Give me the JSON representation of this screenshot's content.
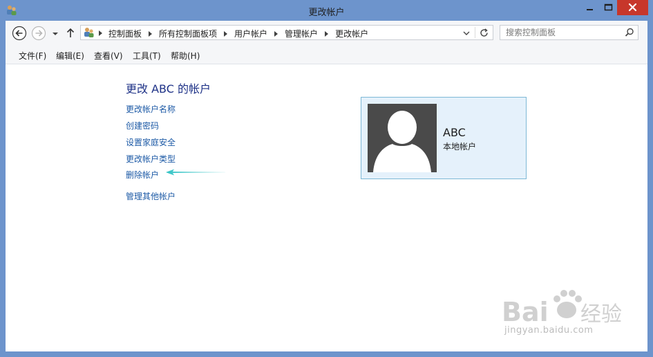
{
  "window": {
    "title": "更改帐户"
  },
  "nav": {
    "breadcrumb": [
      "控制面板",
      "所有控制面板项",
      "用户帐户",
      "管理帐户",
      "更改帐户"
    ],
    "search_placeholder": "搜索控制面板"
  },
  "menu": [
    "文件(F)",
    "编辑(E)",
    "查看(V)",
    "工具(T)",
    "帮助(H)"
  ],
  "main": {
    "heading": "更改 ABC 的帐户",
    "tasks": [
      "更改帐户名称",
      "创建密码",
      "设置家庭安全",
      "更改帐户类型",
      "删除帐户",
      "管理其他帐户"
    ]
  },
  "account": {
    "name": "ABC",
    "type": "本地帐户"
  },
  "watermark": {
    "brand": "Bai",
    "brand2": "经验",
    "url": "jingyan.baidu.com"
  },
  "colors": {
    "link": "#1d5aa6",
    "heading": "#1e3287",
    "arrow": "#3cc8c8",
    "close": "#c7372b",
    "frame": "#6d94cc"
  }
}
